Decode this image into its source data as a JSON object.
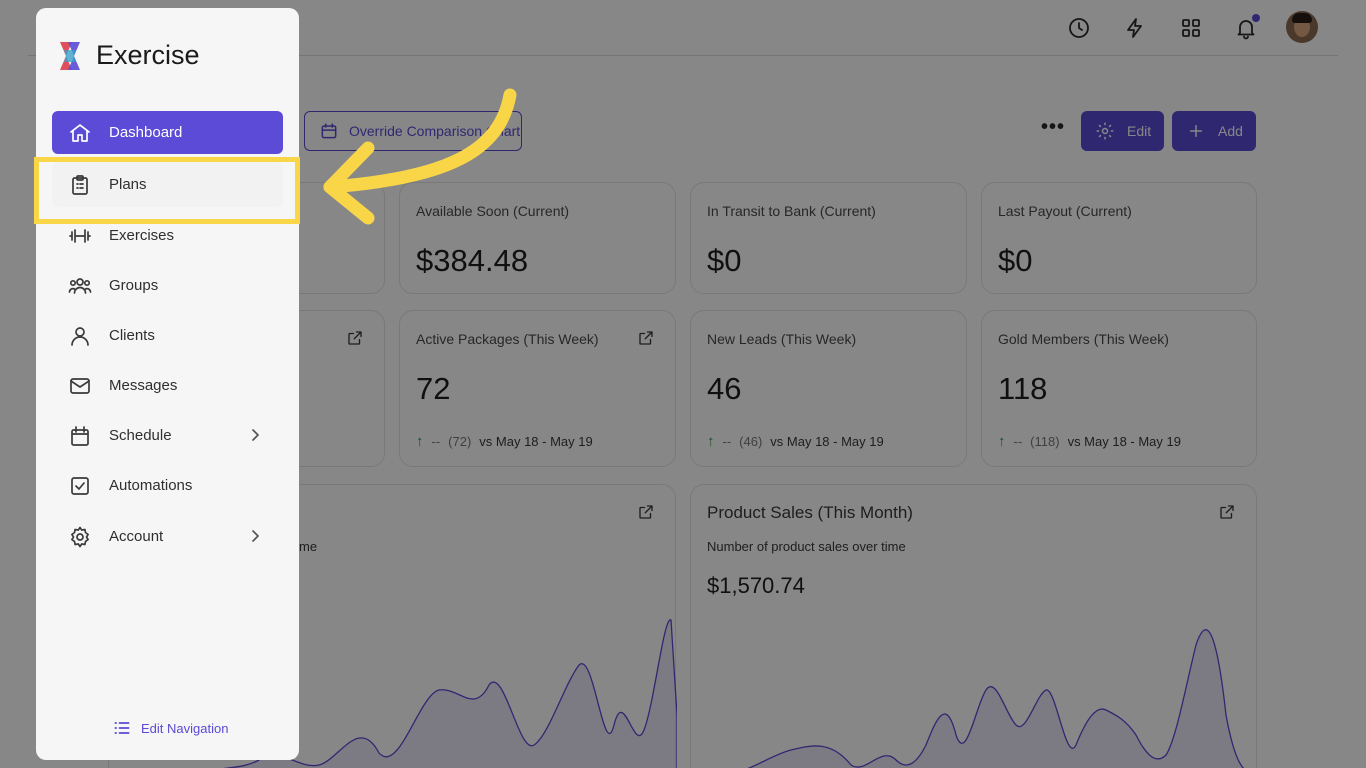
{
  "topbar": {
    "icons": [
      "clock-icon",
      "bolt-icon",
      "grid-icon",
      "bell-icon"
    ]
  },
  "actions": {
    "override_label": "Override Comparison Chart",
    "edit_label": "Edit",
    "add_label": "Add"
  },
  "stats_row1": [
    {
      "label": "Available Soon (Current)",
      "value": "$384.48"
    },
    {
      "label": "In Transit to Bank (Current)",
      "value": "$0"
    },
    {
      "label": "Last Payout (Current)",
      "value": "$0"
    }
  ],
  "stats_row2": [
    {
      "label": "Active Packages (This Week)",
      "value": "72",
      "dash": "--",
      "prev": "(72)",
      "compare": "vs May 18 - May 19"
    },
    {
      "label": "New Leads (This Week)",
      "value": "46",
      "dash": "--",
      "prev": "(46)",
      "compare": "vs May 18 - May 19"
    },
    {
      "label": "Gold Members (This Week)",
      "value": "118",
      "dash": "--",
      "prev": "(118)",
      "compare": "vs May 18 - May 19"
    }
  ],
  "left_chart": {
    "subtitle_fragment": "me"
  },
  "product_chart": {
    "title": "Product Sales (This Month)",
    "subtitle": "Number of product sales over time",
    "total": "$1,570.74"
  },
  "sidebar": {
    "brand": "Exercise",
    "items": [
      {
        "label": "Dashboard",
        "icon": "home-icon"
      },
      {
        "label": "Plans",
        "icon": "clipboard-icon"
      },
      {
        "label": "Exercises",
        "icon": "dumbbell-icon"
      },
      {
        "label": "Groups",
        "icon": "users-icon"
      },
      {
        "label": "Clients",
        "icon": "user-icon"
      },
      {
        "label": "Messages",
        "icon": "mail-icon"
      },
      {
        "label": "Schedule",
        "icon": "calendar-icon"
      },
      {
        "label": "Automations",
        "icon": "checkbox-icon"
      },
      {
        "label": "Account",
        "icon": "gear-icon"
      }
    ],
    "edit_navigation": "Edit Navigation"
  },
  "colors": {
    "accent": "#5b4bd6",
    "highlight": "#f9d648",
    "trend_up": "#2e9d4f"
  }
}
